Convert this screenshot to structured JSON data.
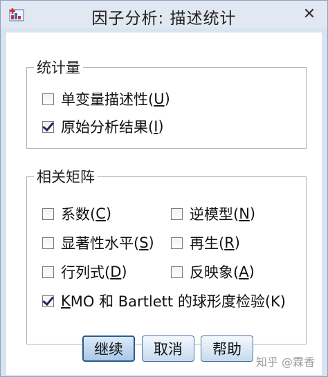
{
  "window": {
    "title": "因子分析: 描述统计",
    "close_glyph": "✕"
  },
  "statistics_group": {
    "title": "统计量",
    "items": [
      {
        "label_prefix": "单变量描述性(",
        "mnemonic": "U",
        "label_suffix": ")",
        "checked": false
      },
      {
        "label_prefix": "原始分析结果(",
        "mnemonic": "I",
        "label_suffix": ")",
        "checked": true
      }
    ]
  },
  "correlation_group": {
    "title": "相关矩阵",
    "items": [
      {
        "label_prefix": "系数(",
        "mnemonic": "C",
        "label_suffix": ")",
        "checked": false
      },
      {
        "label_prefix": "逆模型(",
        "mnemonic": "N",
        "label_suffix": ")",
        "checked": false
      },
      {
        "label_prefix": "显著性水平(",
        "mnemonic": "S",
        "label_suffix": ")",
        "checked": false
      },
      {
        "label_prefix": "再生(",
        "mnemonic": "R",
        "label_suffix": ")",
        "checked": false
      },
      {
        "label_prefix": "行列式(",
        "mnemonic": "D",
        "label_suffix": ")",
        "checked": false
      },
      {
        "label_prefix": "反映象(",
        "mnemonic": "A",
        "label_suffix": ")",
        "checked": false
      },
      {
        "label_prefix": "",
        "mnemonic": "K",
        "label_suffix": "MO 和 Bartlett 的球形度检验(K)",
        "checked": true
      }
    ]
  },
  "buttons": {
    "continue": "继续",
    "cancel": "取消",
    "help": "帮助"
  },
  "watermark": "知乎 @霖香",
  "icons": {
    "app": "spss-factor-icon",
    "close": "close-icon"
  },
  "colors": {
    "frame": "#d9e4f1",
    "button_border": "#4a6f97",
    "check_mark": "#1e2a5a"
  }
}
